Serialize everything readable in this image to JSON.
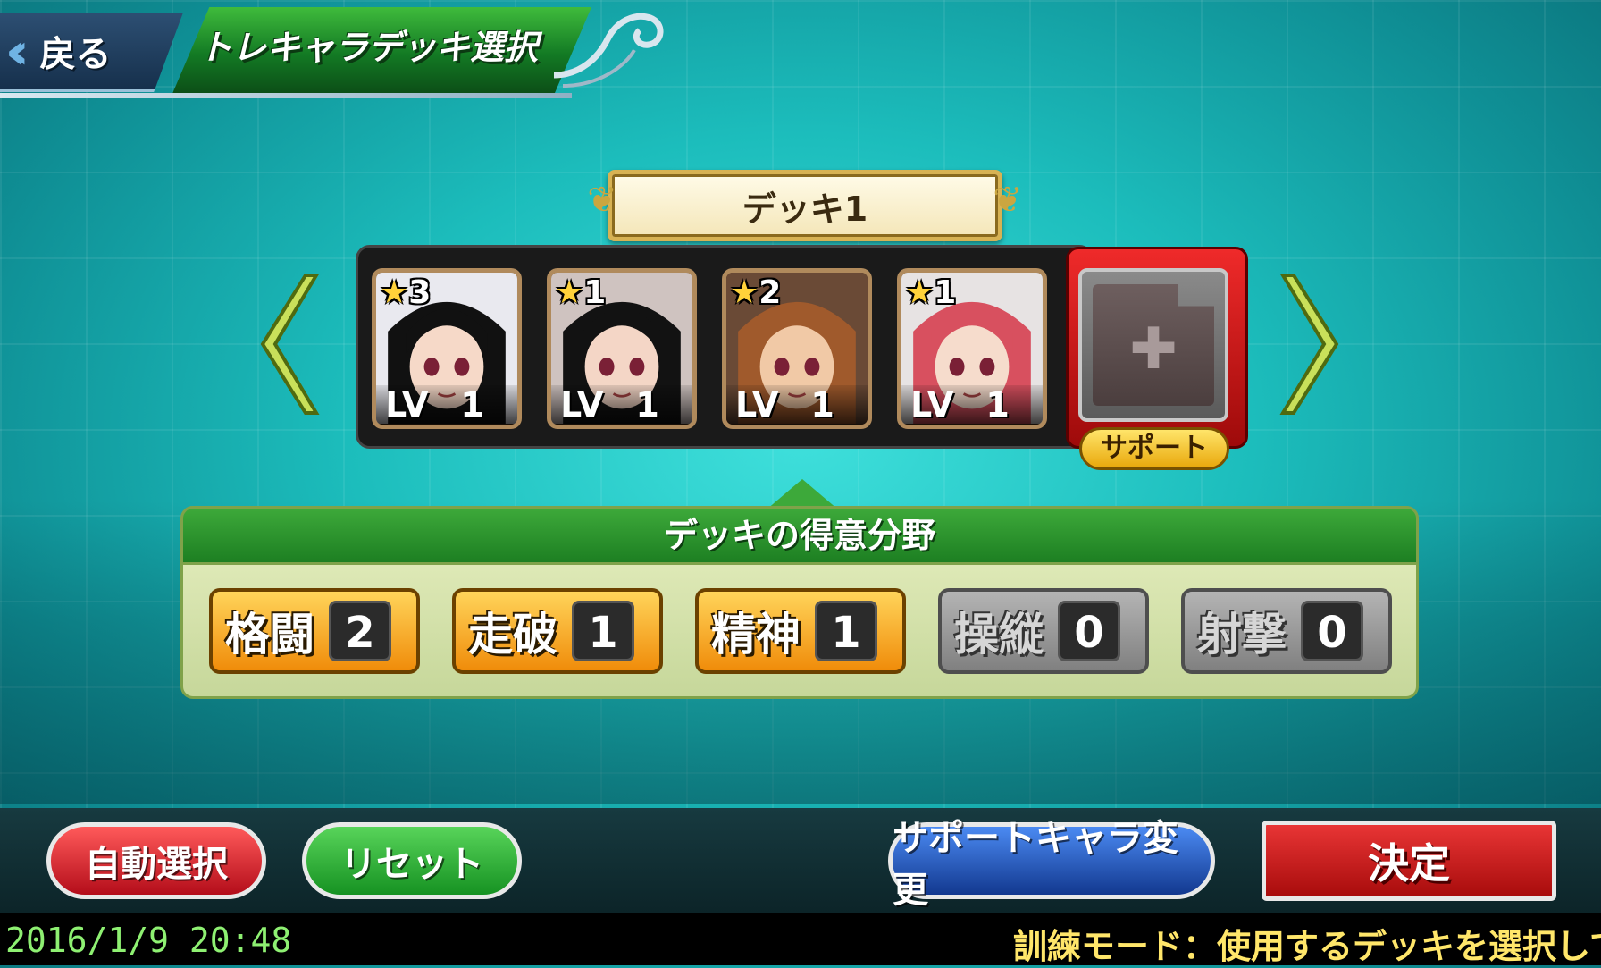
{
  "header": {
    "back_label": "戻る",
    "title": "トレキャラデッキ選択"
  },
  "deck": {
    "name": "デッキ1",
    "cards": [
      {
        "stars": "3",
        "lv_label": "LV",
        "level": "1",
        "hair": "#111111",
        "skin": "#f6d9c8",
        "bg": "#e9e9ef"
      },
      {
        "stars": "1",
        "lv_label": "LV",
        "level": "1",
        "hair": "#121212",
        "skin": "#f4d6c6",
        "bg": "#cfc3c0"
      },
      {
        "stars": "2",
        "lv_label": "LV",
        "level": "1",
        "hair": "#a05a2c",
        "skin": "#f1c9a6",
        "bg": "#6a4a36"
      },
      {
        "stars": "1",
        "lv_label": "LV",
        "level": "1",
        "hair": "#d8505f",
        "skin": "#f6dccc",
        "bg": "#e7e3e3"
      }
    ],
    "support_label": "サポート"
  },
  "specialty": {
    "title": "デッキの得意分野",
    "skills": [
      {
        "name": "格闘",
        "value": "2",
        "active": true
      },
      {
        "name": "走破",
        "value": "1",
        "active": true
      },
      {
        "name": "精神",
        "value": "1",
        "active": true
      },
      {
        "name": "操縦",
        "value": "0",
        "active": false
      },
      {
        "name": "射撃",
        "value": "0",
        "active": false
      }
    ]
  },
  "buttons": {
    "auto_select": "自動選択",
    "reset": "リセット",
    "change_support": "サポートキャラ変更",
    "confirm": "決定"
  },
  "status": {
    "datetime": "2016/1/9  20:48",
    "ticker": "訓練モード：使用するデッキを選択して"
  },
  "icons": {
    "back": "double-chevron-left-icon",
    "prev": "chevron-left-icon",
    "next": "chevron-right-icon",
    "star": "star-icon",
    "plus": "plus-icon"
  }
}
